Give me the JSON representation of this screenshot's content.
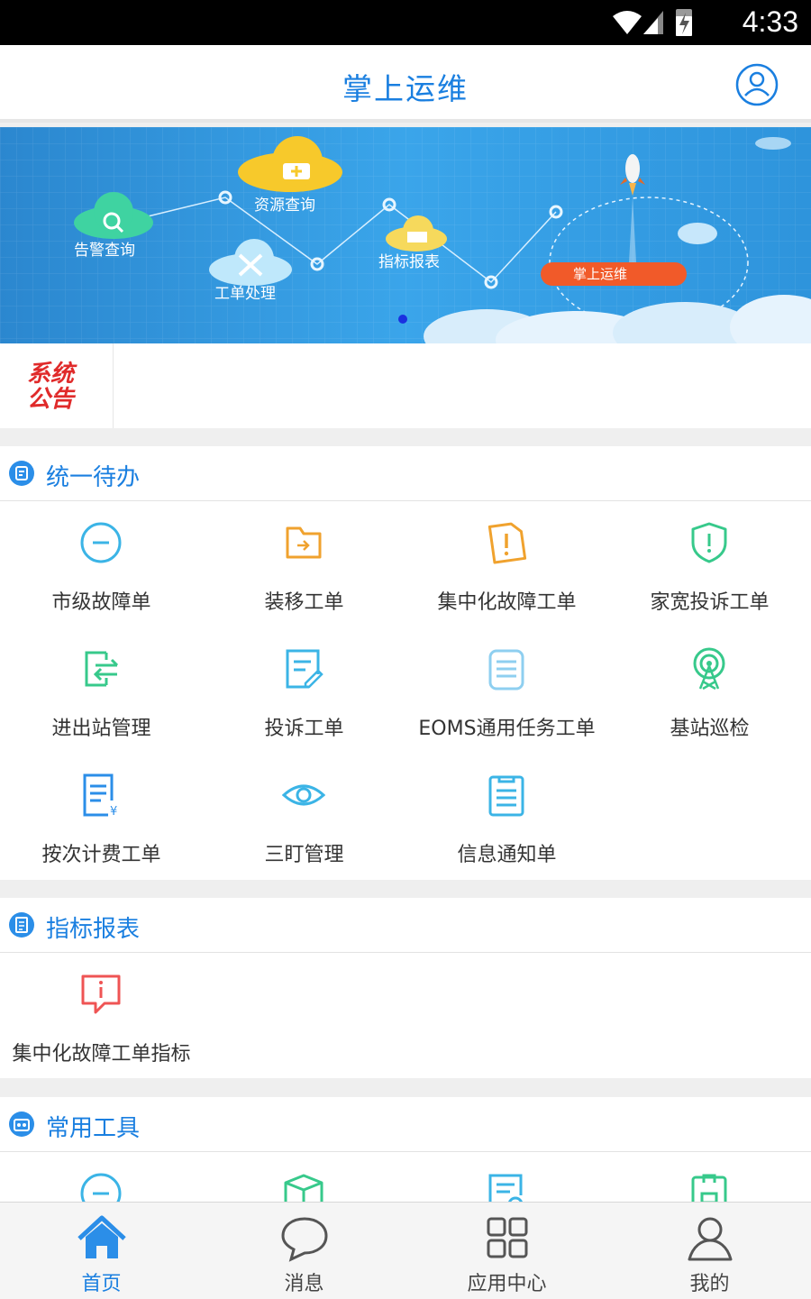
{
  "status_bar": {
    "time": "4:33"
  },
  "header": {
    "title": "掌上运维"
  },
  "banner": {
    "labels": {
      "alarm": "告警查询",
      "resource": "资源查询",
      "workorder": "工单处理",
      "report": "指标报表",
      "app": "掌上运维"
    }
  },
  "notice": {
    "logo_line1": "系统",
    "logo_line2": "公告"
  },
  "sections": [
    {
      "title": "统一待办",
      "items": [
        {
          "label": "市级故障单",
          "icon": "minus-circle-icon"
        },
        {
          "label": "装移工单",
          "icon": "folder-arrow-icon"
        },
        {
          "label": "集中化故障工单",
          "icon": "warning-document-icon"
        },
        {
          "label": "家宽投诉工单",
          "icon": "shield-alert-icon"
        },
        {
          "label": "进出站管理",
          "icon": "exit-arrows-icon"
        },
        {
          "label": "投诉工单",
          "icon": "document-edit-icon"
        },
        {
          "label": "EOMS通用任务工单",
          "icon": "notepad-icon"
        },
        {
          "label": "基站巡检",
          "icon": "tower-signal-icon"
        },
        {
          "label": "按次计费工单",
          "icon": "billing-document-icon"
        },
        {
          "label": "三盯管理",
          "icon": "eye-icon"
        },
        {
          "label": "信息通知单",
          "icon": "clipboard-list-icon"
        }
      ]
    },
    {
      "title": "指标报表",
      "items": [
        {
          "label": "集中化故障工单指标",
          "icon": "info-chat-icon"
        }
      ]
    },
    {
      "title": "常用工具",
      "items": [
        {
          "label": "",
          "icon": "minus-circle-icon"
        },
        {
          "label": "",
          "icon": "box-icon"
        },
        {
          "label": "",
          "icon": "document-search-icon"
        },
        {
          "label": "",
          "icon": "clipboard-icon"
        }
      ]
    }
  ],
  "tabbar": [
    {
      "label": "首页",
      "icon": "home-icon",
      "active": true
    },
    {
      "label": "消息",
      "icon": "chat-bubble-icon",
      "active": false
    },
    {
      "label": "应用中心",
      "icon": "grid-apps-icon",
      "active": false
    },
    {
      "label": "我的",
      "icon": "user-icon",
      "active": false
    }
  ],
  "colors": {
    "accent": "#1a7fe0",
    "cyan": "#3bb4e6",
    "orange": "#f0a22e",
    "green": "#37c98b",
    "red": "#ef5454"
  }
}
